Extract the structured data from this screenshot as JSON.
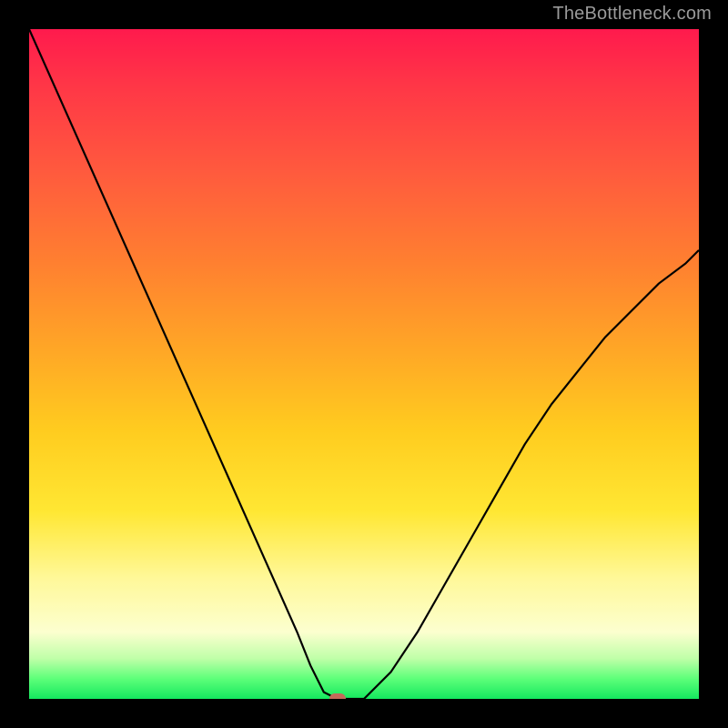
{
  "watermark": "TheBottleneck.com",
  "chart_data": {
    "type": "line",
    "title": "",
    "xlabel": "",
    "ylabel": "",
    "xlim": [
      0,
      100
    ],
    "ylim": [
      0,
      100
    ],
    "background_gradient": [
      {
        "pos": 0,
        "color": "#ff1a4d"
      },
      {
        "pos": 22,
        "color": "#ff5c3d"
      },
      {
        "pos": 48,
        "color": "#ffa726"
      },
      {
        "pos": 72,
        "color": "#ffe733"
      },
      {
        "pos": 90,
        "color": "#fcffcf"
      },
      {
        "pos": 100,
        "color": "#14e85f"
      }
    ],
    "series": [
      {
        "name": "bottleneck-curve",
        "color": "#000000",
        "x": [
          0,
          4,
          8,
          12,
          16,
          20,
          24,
          28,
          32,
          36,
          40,
          42,
          44,
          46,
          50,
          54,
          58,
          62,
          66,
          70,
          74,
          78,
          82,
          86,
          90,
          94,
          98,
          100
        ],
        "y": [
          100,
          91,
          82,
          73,
          64,
          55,
          46,
          37,
          28,
          19,
          10,
          5,
          1,
          0,
          0,
          4,
          10,
          17,
          24,
          31,
          38,
          44,
          49,
          54,
          58,
          62,
          65,
          67
        ]
      }
    ],
    "marker": {
      "x": 46,
      "y": 0,
      "color": "#c46a5a",
      "shape": "rounded-rect"
    }
  }
}
